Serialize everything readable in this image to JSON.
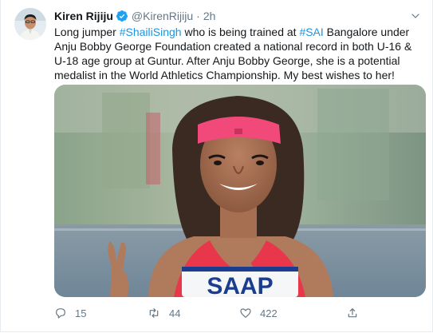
{
  "tweet": {
    "author_name": "Kiren Rijiju",
    "handle": "@KirenRijiju",
    "separator": "·",
    "time": "2h",
    "text": {
      "p1": "Long jumper ",
      "tag1": "#ShailiSingh",
      "p2": " who is being trained at ",
      "tag2": "#SAI",
      "p3": " Bangalore under Anju Bobby George Foundation created a national record in both U-16 & U-18 age group at Guntur. After Anju Bobby George, she is a potential medalist in the World Athletics Championship. My best wishes to her!"
    },
    "media": {
      "bib_text": "SAAP"
    },
    "actions": {
      "replies": "15",
      "retweets": "44",
      "likes": "422"
    }
  },
  "colors": {
    "link": "#1b95e0",
    "muted": "#657786",
    "verified": "#1da1f2",
    "headband": "#f0497a",
    "jersey": "#e8374a"
  },
  "icons": [
    "verified-badge-icon",
    "caret-down-icon",
    "reply-icon",
    "retweet-icon",
    "like-icon",
    "share-icon"
  ]
}
